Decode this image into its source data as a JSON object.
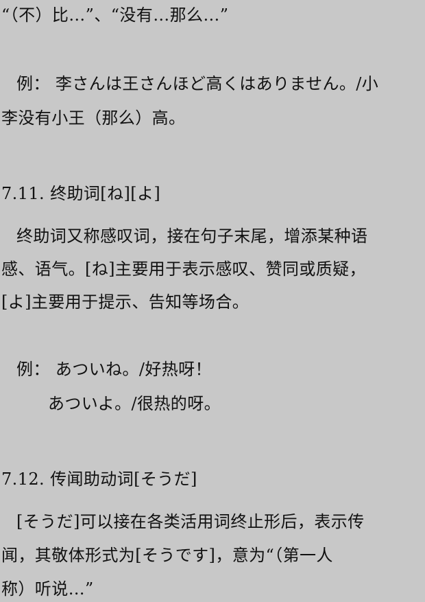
{
  "document": {
    "lines": [
      "“（不）比…”、“没有…那么…”",
      "例：  李さんは王さんほど高くはありません。/小",
      "李没有小王（那么）高。",
      "7.11.  终助词[ね][よ]",
      "终助词又称感叹词，接在句子末尾，增添某种语",
      "感、语气。[ね]主要用于表示感叹、赞同或质疑，",
      "[よ]主要用于提示、告知等场合。",
      "例：  あついね。/好热呀！",
      "あついよ。/很热的呀。",
      "7.12.  传闻助动词[そうだ]",
      "[そうだ]可以接在各类活用词终止形后，表示传",
      "闻，其敬体形式为[そうです]，意为“（第一人",
      "称）听说…”"
    ]
  }
}
